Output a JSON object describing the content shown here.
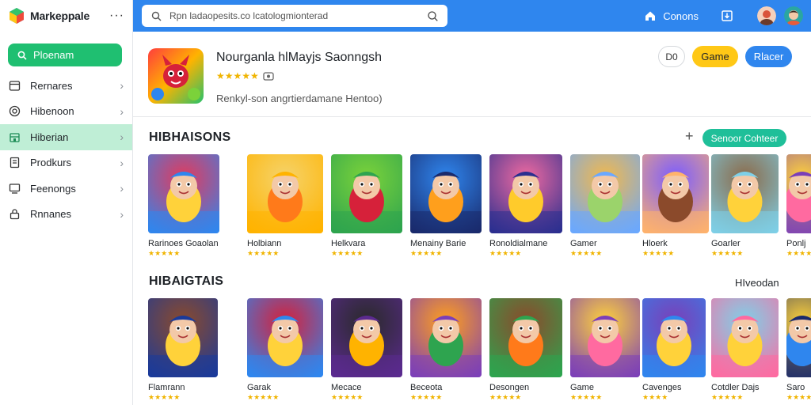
{
  "brand": {
    "name": "Markeppale",
    "more": "···"
  },
  "sidebar": {
    "search_label": "Ploenam",
    "items": [
      {
        "label": "Rernares",
        "icon": "window-icon",
        "active": false
      },
      {
        "label": "Hibenoon",
        "icon": "target-icon",
        "active": false
      },
      {
        "label": "Hiberian",
        "icon": "store-icon",
        "active": true
      },
      {
        "label": "Prodkurs",
        "icon": "document-icon",
        "active": false
      },
      {
        "label": "Feenongs",
        "icon": "monitor-icon",
        "active": false
      },
      {
        "label": "Rnnanes",
        "icon": "lock-icon",
        "active": false
      }
    ]
  },
  "topbar": {
    "search_placeholder": "Rpn ladaopesits.co lcatologmionterad",
    "home_label": "Conons",
    "accent": "#2f86ee"
  },
  "app": {
    "title": "Nourganla hlMayjs Saonngsh",
    "stars": "★★★★★",
    "rating_icon": "badge-icon",
    "subtitle": "Renkyl-son angrtierdamane Hentoo)",
    "rank_label": "D0",
    "game_label": "Game",
    "primary_label": "Rlacer"
  },
  "section1": {
    "title": "HIBHAISONS",
    "plus": "+",
    "button_label": "Senoor Cohteer",
    "cards": [
      {
        "name": "Rarinoes Goaolan",
        "stars": "★★★★★"
      },
      {
        "name": "Holbiann",
        "stars": "★★★★★"
      },
      {
        "name": "Helkvara",
        "stars": "★★★★★"
      },
      {
        "name": "Menainy Barie",
        "stars": "★★★★★"
      },
      {
        "name": "Ronoldialmane",
        "stars": "★★★★★"
      },
      {
        "name": "Gamer",
        "stars": "★★★★★"
      },
      {
        "name": "Hloerk",
        "stars": "★★★★★"
      },
      {
        "name": "Goarler",
        "stars": "★★★★★"
      },
      {
        "name": "Ponlj",
        "stars": "★★★★"
      }
    ]
  },
  "section2": {
    "title": "HIBAIGTAIS",
    "link_label": "HIveodan",
    "cards": [
      {
        "name": "Flamrann",
        "stars": "★★★★★"
      },
      {
        "name": "Garak",
        "stars": "★★★★★"
      },
      {
        "name": "Mecace",
        "stars": "★★★★★"
      },
      {
        "name": "Beceota",
        "stars": "★★★★★"
      },
      {
        "name": "Desongen",
        "stars": "★★★★★"
      },
      {
        "name": "Game",
        "stars": "★★★★★"
      },
      {
        "name": "Cavenges",
        "stars": "★★★★"
      },
      {
        "name": "Cotdler Dajs",
        "stars": "★★★★★"
      },
      {
        "name": "Saro",
        "stars": "★★★★"
      }
    ]
  }
}
